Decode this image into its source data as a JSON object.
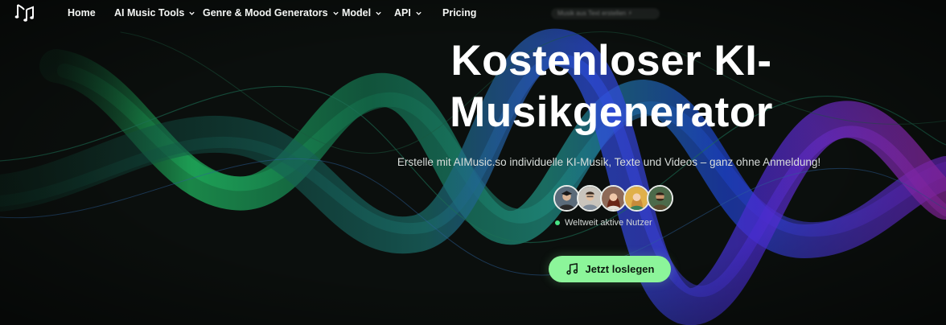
{
  "nav": {
    "items": [
      {
        "label": "Home",
        "has_dropdown": false
      },
      {
        "label": "AI Music Tools",
        "has_dropdown": true
      },
      {
        "label": "Genre & Mood Generators",
        "has_dropdown": true
      },
      {
        "label": "Model",
        "has_dropdown": true
      },
      {
        "label": "API",
        "has_dropdown": true
      },
      {
        "label": "Pricing",
        "has_dropdown": false
      }
    ],
    "logo_icon": "music-notes-icon"
  },
  "promo_text": "Musik aus Text erstellen ⚡",
  "hero": {
    "title_line1": "Kostenloser KI-",
    "title_line2": "Musikgenerator",
    "subtitle": "Erstelle mit AIMusic.so individuelle KI-Musik, Texte und Videos – ganz ohne Anmeldung!",
    "active_users_label": "Weltweit aktive Nutzer",
    "cta_label": "Jetzt loslegen",
    "cta_icon": "music-note-icon"
  },
  "colors": {
    "background": "#0c100e",
    "accent_green": "#8cf59a",
    "status_dot": "#49e384",
    "wave_green": "#1f9e57",
    "wave_blue": "#2a4fd8",
    "wave_purple": "#7a2ec9"
  }
}
